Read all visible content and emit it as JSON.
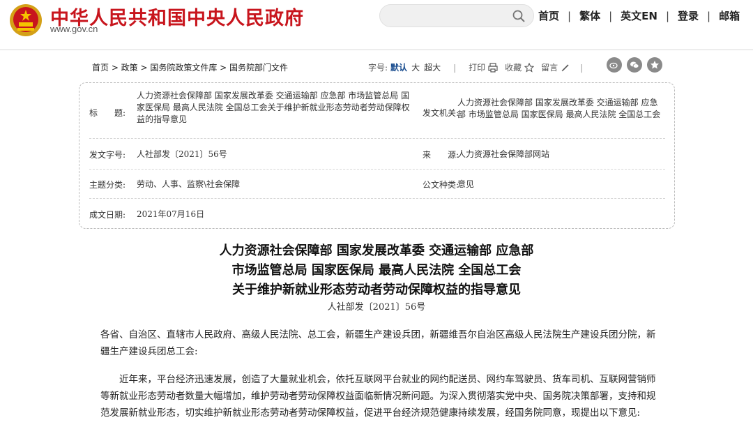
{
  "header": {
    "site_title": "中华人民共和国中央人民政府",
    "site_url": "www.gov.cn",
    "search": {
      "placeholder": "",
      "value": ""
    },
    "nav": [
      "首页",
      "繁体",
      "英文EN",
      "登录",
      "邮箱"
    ]
  },
  "toolbar": {
    "breadcrumb": "首页 > 政策 > 国务院政策文件库 > 国务院部门文件",
    "font_size_label": "字号:",
    "font_sizes": [
      "默认",
      "大",
      "超大"
    ],
    "print_label": "打印",
    "favorite_label": "收藏",
    "comment_label": "留言"
  },
  "info": {
    "title_label": "标　　题:",
    "title_value": "人力资源社会保障部 国家发展改革委 交通运输部 应急部 市场监管总局 国家医保局 最高人民法院 全国总工会关于维护新就业形态劳动者劳动保障权益的指导意见",
    "issuer_label": "发文机关:",
    "issuer_value": "人力资源社会保障部 国家发展改革委 交通运输部 应急部 市场监管总局 国家医保局 最高人民法院 全国总工会",
    "doc_no_label": "发文字号:",
    "doc_no_value": "人社部发〔2021〕56号",
    "source_label": "来　　源:",
    "source_value": "人力资源社会保障部网站",
    "topic_label": "主题分类:",
    "topic_value": "劳动、人事、监察\\社会保障",
    "type_label": "公文种类:",
    "type_value": "意见",
    "date_label": "成文日期:",
    "date_value": "2021年07月16日"
  },
  "article": {
    "title_lines": [
      "人力资源社会保障部 国家发展改革委 交通运输部 应急部",
      "市场监管总局 国家医保局 最高人民法院 全国总工会",
      "关于维护新就业形态劳动者劳动保障权益的指导意见"
    ],
    "doc_no": "人社部发〔2021〕56号",
    "addressee": "各省、自治区、直辖市人民政府、高级人民法院、总工会，新疆生产建设兵团，新疆维吾尔自治区高级人民法院生产建设兵团分院，新疆生产建设兵团总工会:",
    "paragraph1": "近年来，平台经济迅速发展，创造了大量就业机会，依托互联网平台就业的网约配送员、网约车驾驶员、货车司机、互联网营销师等新就业形态劳动者数量大幅增加，维护劳动者劳动保障权益面临新情况新问题。为深入贯彻落实党中央、国务院决策部署，支持和规范发展新就业形态，切实维护新就业形态劳动者劳动保障权益，促进平台经济规范健康持续发展，经国务院同意，现提出以下意见:"
  },
  "colors": {
    "brand_red": "#c8151d",
    "link_blue": "#1a4d8f"
  }
}
